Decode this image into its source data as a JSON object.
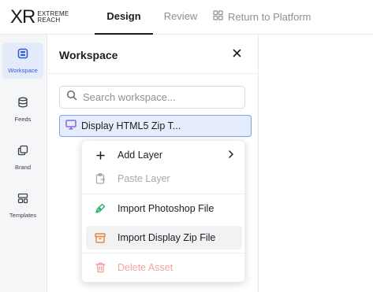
{
  "topbar": {
    "logo_mark": "XR",
    "logo_line1": "EXTREME",
    "logo_line2": "REACH",
    "tabs": [
      {
        "label": "Design",
        "active": true
      },
      {
        "label": "Review",
        "active": false
      },
      {
        "label": "Return to Platform",
        "icon": "grid-icon"
      }
    ]
  },
  "rail": {
    "items": [
      {
        "label": "Workspace",
        "icon": "workspace-icon",
        "active": true
      },
      {
        "label": "Feeds",
        "icon": "database-icon",
        "active": false
      },
      {
        "label": "Brand",
        "icon": "brand-icon",
        "active": false
      },
      {
        "label": "Templates",
        "icon": "templates-icon",
        "active": false
      }
    ]
  },
  "panel": {
    "title": "Workspace",
    "search_placeholder": "Search workspace...",
    "asset_name": "Display HTML5 Zip T..."
  },
  "context_menu": {
    "items": [
      {
        "label": "Add Layer",
        "icon": "plus-icon",
        "state": "normal",
        "has_submenu": true
      },
      {
        "label": "Paste Layer",
        "icon": "paste-icon",
        "state": "disabled"
      },
      {
        "label": "Import Photoshop File",
        "icon": "photoshop-icon",
        "state": "normal"
      },
      {
        "label": "Import Display Zip File",
        "icon": "archive-icon",
        "state": "hover"
      },
      {
        "label": "Delete Asset",
        "icon": "trash-icon",
        "state": "disabled-danger"
      }
    ]
  },
  "colors": {
    "accent": "#2f5bd3",
    "active_bg": "#e3ebfb",
    "selected_border": "#7fa2ec",
    "photoshop_green": "#2fae6a",
    "archive_orange": "#e8843a",
    "danger_faded": "#f2a3a3"
  }
}
